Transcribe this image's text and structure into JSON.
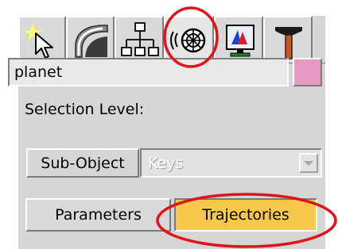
{
  "tabs": [
    {
      "id": "create",
      "icon": "create-cursor-star-icon",
      "active": false
    },
    {
      "id": "modify",
      "icon": "modify-rainbow-curve-icon",
      "active": false
    },
    {
      "id": "hierarchy",
      "icon": "hierarchy-tree-icon",
      "active": false
    },
    {
      "id": "motion",
      "icon": "motion-wheel-icon",
      "active": true
    },
    {
      "id": "display",
      "icon": "display-monitor-icon",
      "active": false
    },
    {
      "id": "utilities",
      "icon": "utilities-hammer-icon",
      "active": false
    }
  ],
  "object": {
    "name": "planet",
    "color": "#e799c2"
  },
  "selection": {
    "label": "Selection Level:",
    "subobject_label": "Sub-Object",
    "level_value": "Keys"
  },
  "buttons": {
    "parameters_label": "Parameters",
    "trajectories_label": "Trajectories"
  },
  "colors": {
    "panel": "#d6d6d6",
    "active_button": "#f5c84a",
    "highlight_ring": "#e0141c"
  }
}
